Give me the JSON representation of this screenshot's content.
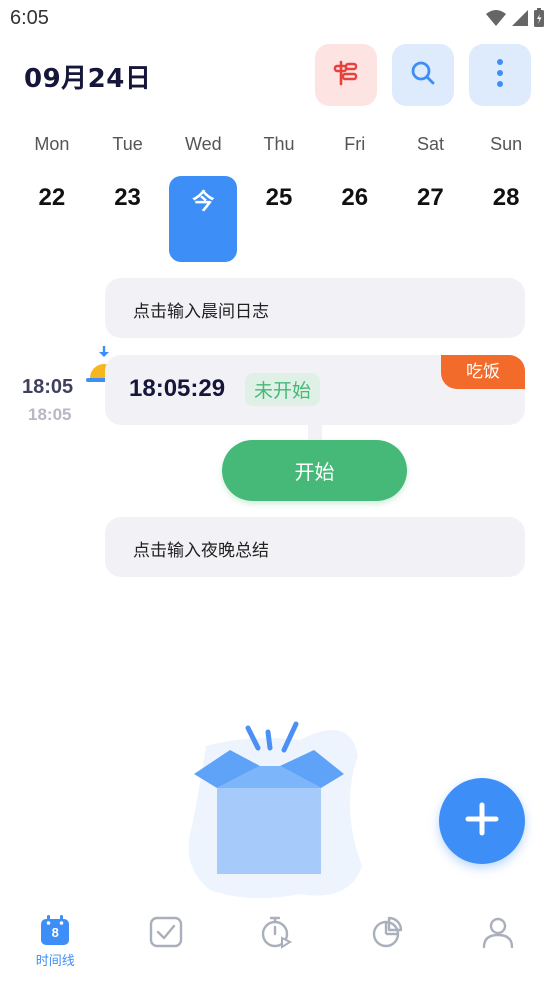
{
  "status_bar": {
    "time": "6:05"
  },
  "header": {
    "date_title": "09月24日"
  },
  "week": {
    "days_of_week": [
      "Mon",
      "Tue",
      "Wed",
      "Thu",
      "Fri",
      "Sat",
      "Sun"
    ],
    "dates": [
      "22",
      "23",
      "今",
      "25",
      "26",
      "27",
      "28"
    ],
    "selected_index": 2
  },
  "timeline": {
    "morning_log_placeholder": "点击输入晨间日志",
    "event": {
      "time_main": "18:05",
      "time_sub": "18:05",
      "clock": "18:05:29",
      "status": "未开始",
      "tag": "吃饭"
    },
    "start_label": "开始",
    "night_summary_placeholder": "点击输入夜晚总结"
  },
  "tabbar": {
    "active_index": 0,
    "tabs": [
      {
        "icon": "calendar-icon",
        "badge": "8",
        "label": "时间线"
      },
      {
        "icon": "checkbox-icon"
      },
      {
        "icon": "timer-icon"
      },
      {
        "icon": "pie-chart-icon"
      },
      {
        "icon": "person-icon"
      }
    ]
  },
  "colors": {
    "accent": "#3d8ef7",
    "start_green": "#46b877",
    "tag_orange": "#f26b2a",
    "header_red_btn": "#fde4e3",
    "header_blue_btn": "#deebfd"
  }
}
